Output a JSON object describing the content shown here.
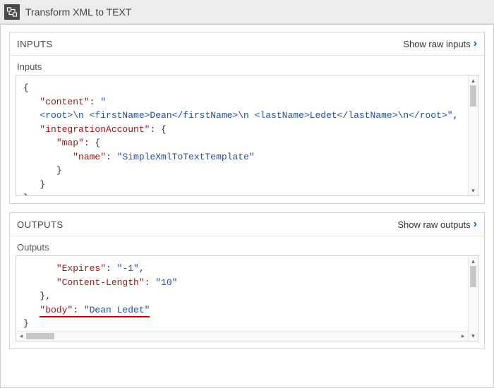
{
  "title": "Transform XML to TEXT",
  "inputs": {
    "header": "INPUTS",
    "showRaw": "Show raw inputs",
    "sublabel": "Inputs",
    "keys": {
      "content": "\"content\"",
      "integrationAccount": "\"integrationAccount\"",
      "map": "\"map\"",
      "name": "\"name\""
    },
    "values": {
      "content_open": "\"",
      "content_xml": "<root>\\n <firstName>Dean</firstName>\\n <lastName>Ledet</lastName>\\n</root>\"",
      "name": "\"SimpleXmlToTextTemplate\""
    },
    "punct": {
      "obrace": "{",
      "cbrace": "}",
      "colon": ": ",
      "comma": ",",
      "colon_obrace": ": {"
    }
  },
  "outputs": {
    "header": "OUTPUTS",
    "showRaw": "Show raw outputs",
    "sublabel": "Outputs",
    "keys": {
      "expires": "\"Expires\"",
      "contentLength": "\"Content-Length\"",
      "body": "\"body\""
    },
    "values": {
      "expires": "\"-1\"",
      "contentLength": "\"10\"",
      "body": "\"Dean Ledet\""
    },
    "punct": {
      "colon": ": ",
      "comma": ",",
      "cbrace_comma": "},",
      "cbrace": "}"
    }
  }
}
